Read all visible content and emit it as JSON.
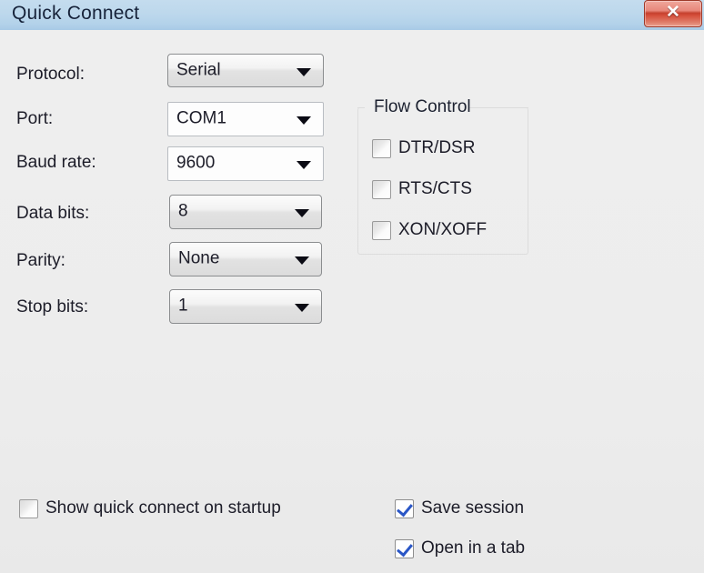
{
  "window": {
    "title": "Quick Connect",
    "close_icon": "close-icon",
    "close_glyph": "✕",
    "titlebar_color": "#b9d4ea",
    "body_color": "#ececec",
    "close_button_color": "#d6503c",
    "accent_check_color": "#2a56c6"
  },
  "form": {
    "fields": [
      {
        "label": "Protocol:",
        "value": "Serial",
        "style": "gray",
        "name": "protocol"
      },
      {
        "label": "Port:",
        "value": "COM1",
        "style": "white",
        "name": "port"
      },
      {
        "label": "Baud rate:",
        "value": "9600",
        "style": "white",
        "name": "baud-rate"
      },
      {
        "label": "Data bits:",
        "value": "8",
        "style": "gray",
        "name": "data-bits"
      },
      {
        "label": "Parity:",
        "value": "None",
        "style": "gray",
        "name": "parity"
      },
      {
        "label": "Stop bits:",
        "value": "1",
        "style": "gray",
        "name": "stop-bits"
      }
    ]
  },
  "flow_control": {
    "title": "Flow Control",
    "options": [
      {
        "label": "DTR/DSR",
        "checked": false
      },
      {
        "label": "RTS/CTS",
        "checked": false
      },
      {
        "label": "XON/XOFF",
        "checked": false
      }
    ]
  },
  "footer": {
    "show_on_startup": {
      "label": "Show quick connect on startup",
      "checked": false
    },
    "save_session": {
      "label": "Save session",
      "checked": true
    },
    "open_in_tab": {
      "label": "Open in a tab",
      "checked": true
    }
  }
}
